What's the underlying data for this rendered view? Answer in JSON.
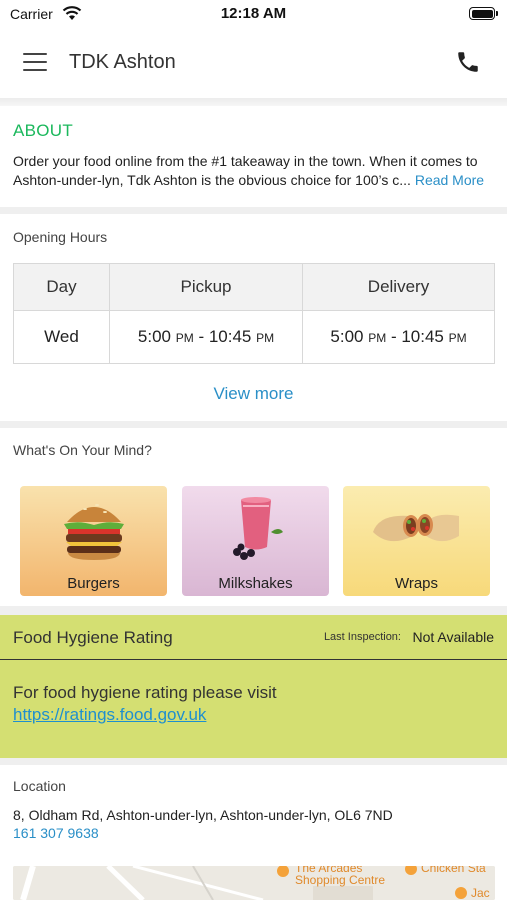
{
  "status_bar": {
    "carrier": "Carrier",
    "time": "12:18 AM"
  },
  "nav": {
    "title": "TDK Ashton",
    "menu_icon": "hamburger-icon",
    "phone_icon": "phone-icon"
  },
  "about": {
    "title": "ABOUT",
    "text_line1": "Order your food online from the #1 takeaway in the town. When it comes to",
    "text_line2": "Ashton-under-lyn, Tdk Ashton is the obvious choice for 100’s c...",
    "read_more": "Read More"
  },
  "opening_hours": {
    "label": "Opening Hours",
    "headers": [
      "Day",
      "Pickup",
      "Delivery"
    ],
    "rows": [
      {
        "day": "Wed",
        "pickup_start": "5:00",
        "pickup_start_ampm": "PM",
        "pickup_sep": " - ",
        "pickup_end": "10:45",
        "pickup_end_ampm": "PM",
        "delivery_start": "5:00",
        "delivery_start_ampm": "PM",
        "delivery_sep": " - ",
        "delivery_end": "10:45",
        "delivery_end_ampm": "PM"
      }
    ],
    "view_more": "View more"
  },
  "categories": {
    "label": "What's On Your Mind?",
    "items": [
      {
        "name": "Burgers",
        "icon": "burger-icon"
      },
      {
        "name": "Milkshakes",
        "icon": "milkshake-icon"
      },
      {
        "name": "Wraps",
        "icon": "wrap-icon"
      }
    ]
  },
  "hygiene": {
    "title": "Food Hygiene Rating",
    "inspection_label": "Last Inspection:",
    "inspection_value": "Not Available",
    "text": "For food hygiene rating please visit",
    "link": "https://ratings.food.gov.uk",
    "color": "#d4df72"
  },
  "location": {
    "label": "Location",
    "address": "8, Oldham Rd, Ashton-under-lyn, Ashton-under-lyn, OL6 7ND",
    "phone": "161 307 9638",
    "map_labels": [
      "The Arcades",
      "Shopping Centre",
      "Chicken Sta",
      "Jac"
    ]
  },
  "colors": {
    "accent_green": "#1bb85c",
    "link_blue": "#2a8fc7"
  }
}
